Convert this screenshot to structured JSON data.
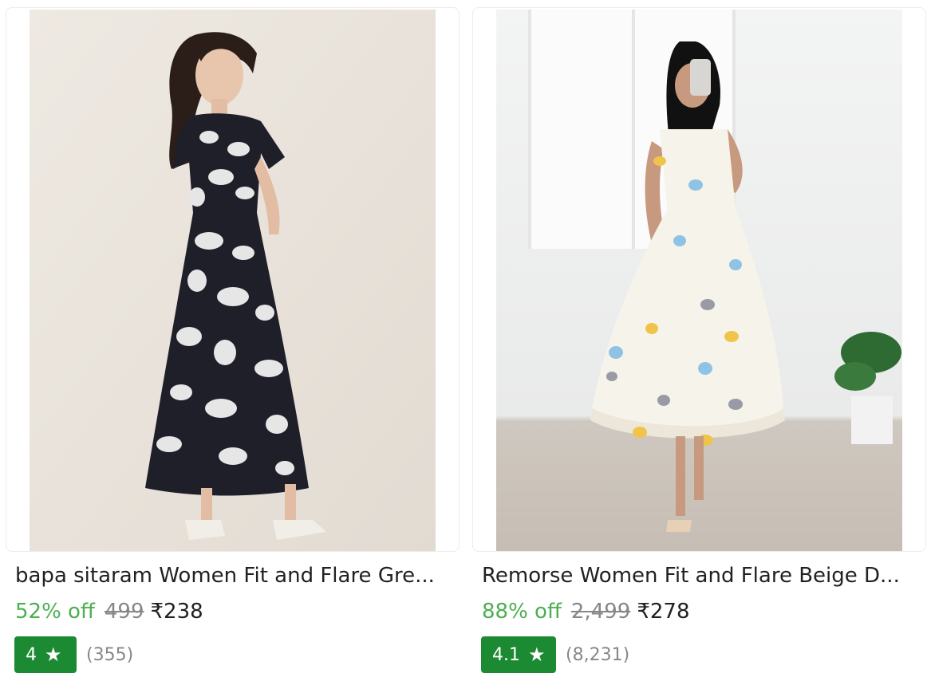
{
  "products": [
    {
      "title": "bapa sitaram Women Fit and Flare Gre...",
      "discount": "52% off",
      "mrp": "499",
      "price": "₹238",
      "rating": "4",
      "reviews": "(355)",
      "image_icon": "dress-photo-icon",
      "colors": {
        "background": "#e9e4dd",
        "dress": "#1f1f2a",
        "print": "#e6e6e6"
      }
    },
    {
      "title": "Remorse Women Fit and Flare Beige D...",
      "discount": "88% off",
      "mrp": "2,499",
      "price": "₹278",
      "rating": "4.1",
      "reviews": "(8,231)",
      "image_icon": "dress-photo-icon",
      "colors": {
        "background": "#eef0f0",
        "dress": "#f6f3ea",
        "print": "#8ec3e6"
      }
    }
  ],
  "colors": {
    "discount": "#4caf50",
    "rating_badge": "#1c8a32",
    "muted_text": "#878787",
    "primary_text": "#212121"
  },
  "icons": {
    "star": "★"
  }
}
